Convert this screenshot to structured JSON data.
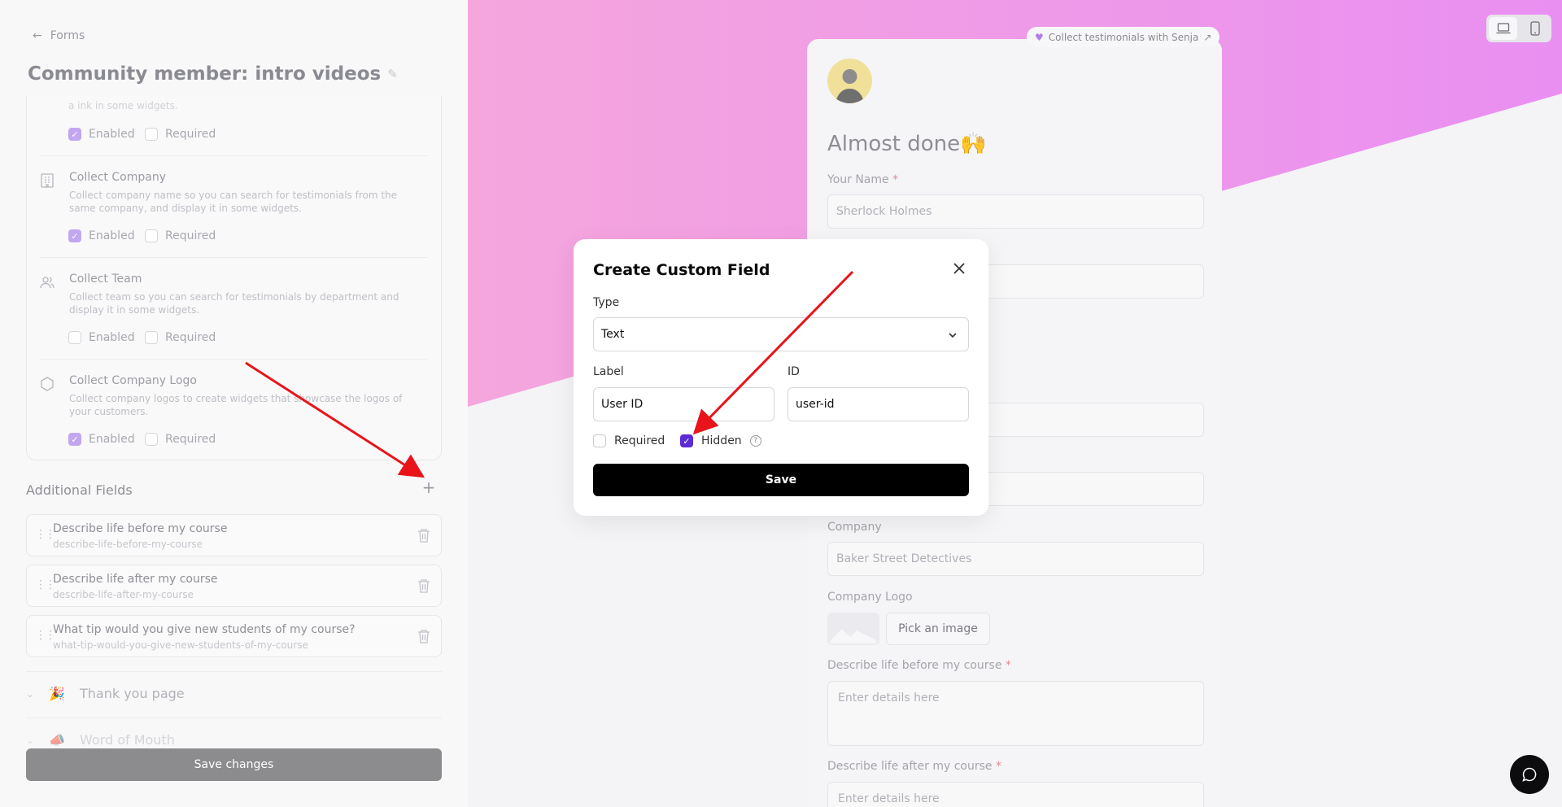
{
  "nav": {
    "back_label": "Forms"
  },
  "form": {
    "title": "Community member: intro videos"
  },
  "collect": {
    "cut_off_text": "a ink in some widgets.",
    "first_row": {
      "enabled_label": "Enabled",
      "required_label": "Required",
      "enabled": true,
      "required": false
    },
    "items": [
      {
        "title": "Collect Company",
        "description": "Collect company name so you can search for testimonials from the same company, and display it in some widgets.",
        "icon": "building-icon",
        "enabled_label": "Enabled",
        "required_label": "Required",
        "enabled": true,
        "required": false
      },
      {
        "title": "Collect Team",
        "description": "Collect team so you can search for testimonials by department and display it in some widgets.",
        "icon": "users-icon",
        "enabled_label": "Enabled",
        "required_label": "Required",
        "enabled": false,
        "required": false
      },
      {
        "title": "Collect Company Logo",
        "description": "Collect company logos to create widgets that showcase the logos of your customers.",
        "icon": "hexagon-icon",
        "enabled_label": "Enabled",
        "required_label": "Required",
        "enabled": true,
        "required": false
      }
    ]
  },
  "additional_fields": {
    "title": "Additional Fields",
    "add_icon": "plus-icon",
    "fields": [
      {
        "label": "Describe life before my course",
        "id": "describe-life-before-my-course"
      },
      {
        "label": "Describe life after my course",
        "id": "describe-life-after-my-course"
      },
      {
        "label": "What tip would you give new students of my course?",
        "id": "what-tip-would-you-give-new-students-of-my-course"
      }
    ]
  },
  "sections": [
    {
      "label": "Thank you page",
      "icon": "party-icon"
    },
    {
      "label": "Word of Mouth",
      "icon": "megaphone-icon"
    }
  ],
  "save_changes_label": "Save changes",
  "preview": {
    "senja_link": "Collect testimonials with Senja",
    "title": "Almost done",
    "title_emoji": "🙌",
    "fields": {
      "name_label": "Your Name",
      "name_placeholder": "Sherlock Holmes",
      "company_label": "Company",
      "company_placeholder": "Baker Street Detectives",
      "logo_label": "Company Logo",
      "pick_image_label": "Pick an image",
      "before_label": "Describe life before my course",
      "before_placeholder": "Enter details here",
      "after_label": "Describe life after my course",
      "after_placeholder": "Enter details here",
      "required_marker": "*"
    },
    "device_toggle": {
      "desktop_icon": "laptop-icon",
      "mobile_icon": "phone-icon",
      "active": "desktop"
    }
  },
  "modal": {
    "title": "Create Custom Field",
    "type_label": "Type",
    "type_value": "Text",
    "label_label": "Label",
    "label_value": "User ID",
    "id_label": "ID",
    "id_value": "user-id",
    "required_label": "Required",
    "required_checked": false,
    "hidden_label": "Hidden",
    "hidden_checked": true,
    "help_icon": "question-icon",
    "save_label": "Save"
  },
  "colors": {
    "accent_purple": "#5b2bd6",
    "preview_gradient_pink": "#f5a6dd",
    "preview_gradient_violet": "#e98ff2",
    "annotation_arrow": "#e8141a",
    "save_button": "#000000",
    "save_changes_button": "#8c8c8e"
  }
}
